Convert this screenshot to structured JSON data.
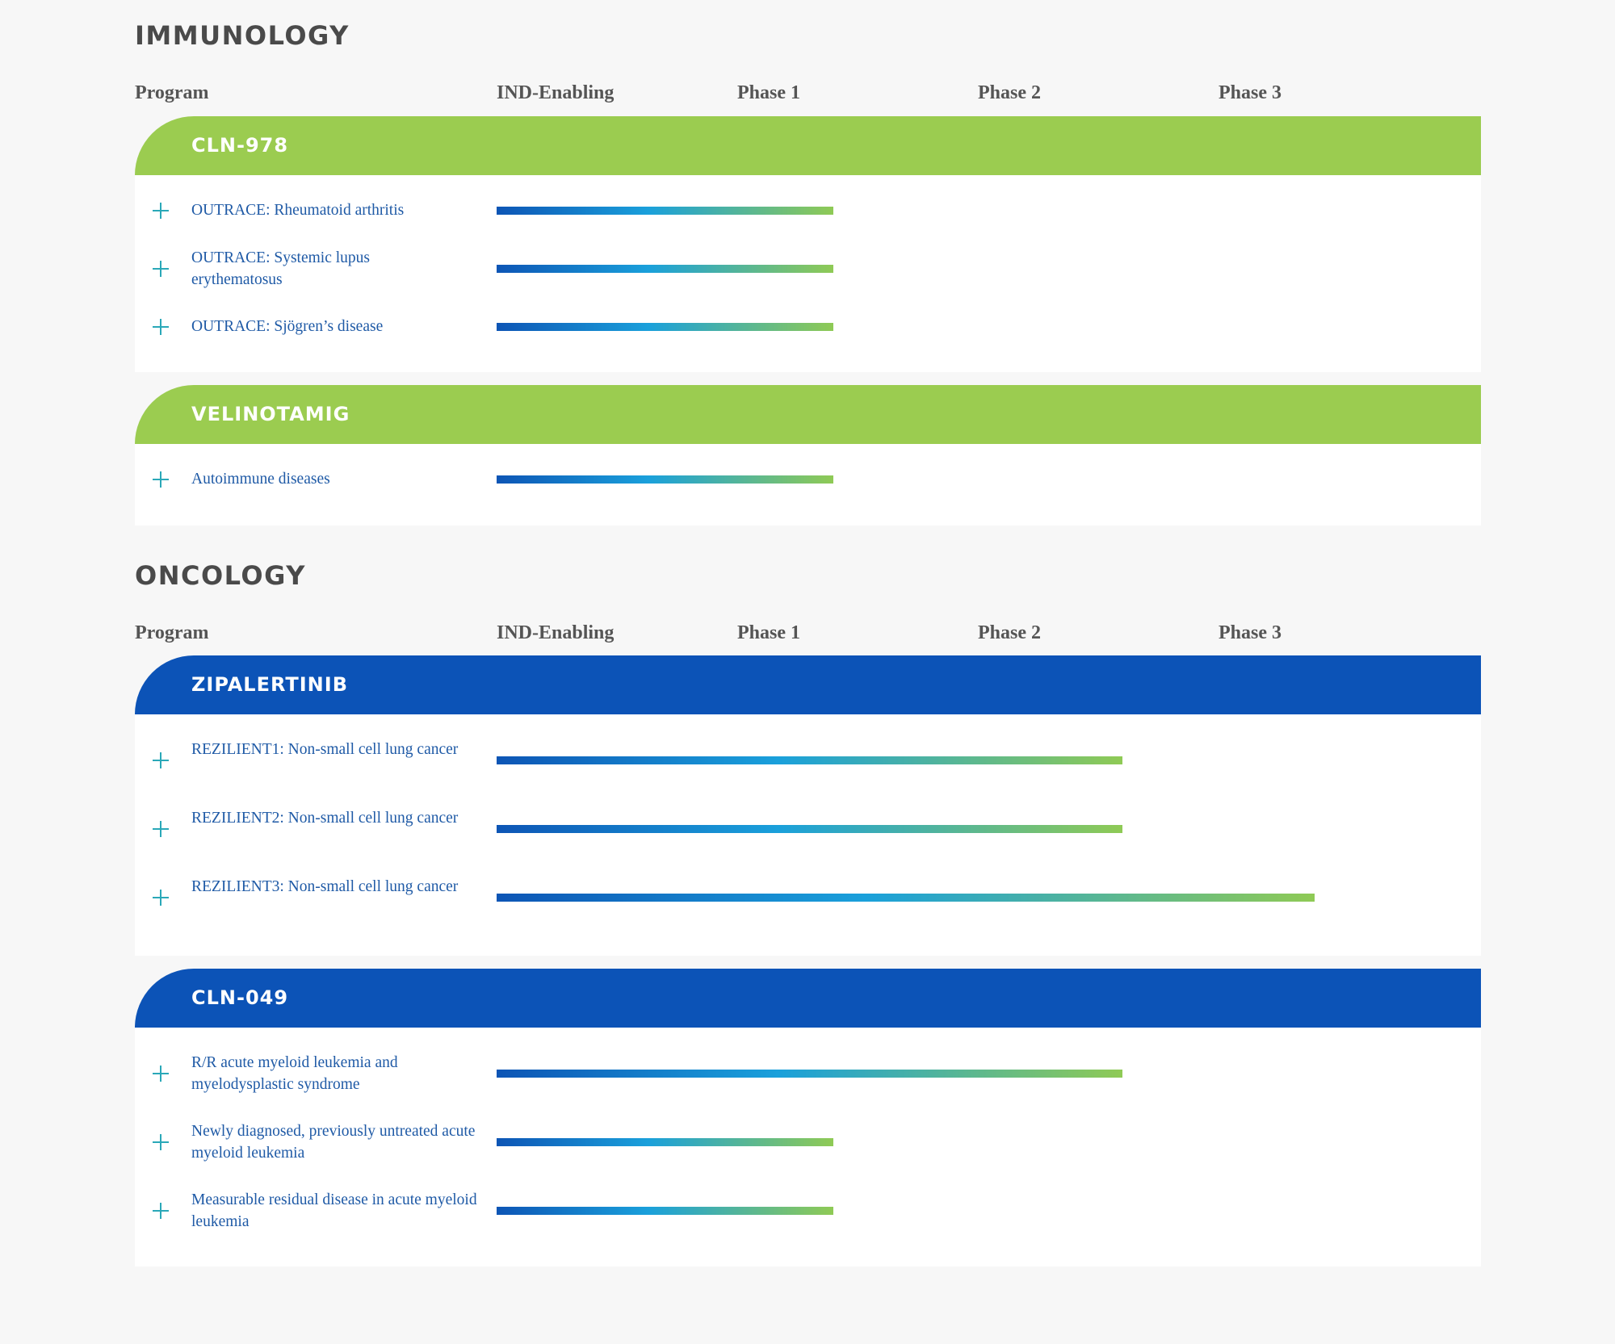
{
  "columns": [
    "Program",
    "IND-Enabling",
    "Phase 1",
    "Phase 2",
    "Phase 3"
  ],
  "stage_scale": {
    "IND-Enabling": 0,
    "Phase 1": 1,
    "Phase 2": 2,
    "Phase 3": 3
  },
  "colors": {
    "immunology_band": "#9bcc50",
    "oncology_band": "#0c53b7",
    "indication_text": "#1f5aa6",
    "plus_icon": "#2aa8b8",
    "bar_gradient": [
      "#0d55b5",
      "#1aa0db",
      "#8fca55"
    ]
  },
  "sections": [
    {
      "title": "IMMUNOLOGY",
      "programs": [
        {
          "name": "CLN-978",
          "indications": [
            {
              "label": "OUTRACE: Rheumatoid arthritis",
              "stage": "Phase 1",
              "progress": 1.4
            },
            {
              "label": "OUTRACE: Systemic lupus erythematosus",
              "stage": "Phase 1",
              "progress": 1.4
            },
            {
              "label": "OUTRACE: Sjögren’s disease",
              "stage": "Phase 1",
              "progress": 1.4
            }
          ]
        },
        {
          "name": "VELINOTAMIG",
          "indications": [
            {
              "label": "Autoimmune diseases",
              "stage": "Phase 1",
              "progress": 1.4
            }
          ]
        }
      ]
    },
    {
      "title": "ONCOLOGY",
      "programs": [
        {
          "name": "ZIPALERTINIB",
          "indications": [
            {
              "label": "REZILIENT1: Non-small cell lung cancer",
              "stage": "Phase 2",
              "progress": 2.6
            },
            {
              "label": "REZILIENT2: Non-small cell lung cancer",
              "stage": "Phase 2",
              "progress": 2.6
            },
            {
              "label": "REZILIENT3: Non-small cell lung cancer",
              "stage": "Phase 3",
              "progress": 3.4
            }
          ]
        },
        {
          "name": "CLN-049",
          "indications": [
            {
              "label": "R/R acute myeloid leukemia and myelodysplastic syndrome",
              "stage": "Phase 2",
              "progress": 2.6
            },
            {
              "label": "Newly diagnosed, previously untreated acute myeloid leukemia",
              "stage": "Phase 1",
              "progress": 1.4
            },
            {
              "label": "Measurable residual disease in acute myeloid leukemia",
              "stage": "Phase 1",
              "progress": 1.4
            }
          ]
        }
      ]
    }
  ]
}
